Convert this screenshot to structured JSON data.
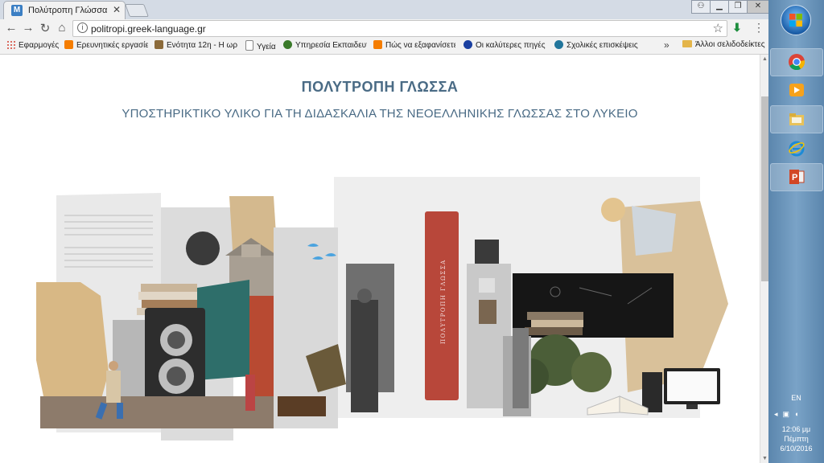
{
  "browser": {
    "tab_title": "Πολύτροπη Γλώσσα",
    "tab_favicon": "M",
    "url": "politropi.greek-language.gr",
    "bookmarks": [
      {
        "label": "Εφαρμογές",
        "icon": "apps-icon",
        "color": "#d23f31"
      },
      {
        "label": "Ερευνητικές εργασίες",
        "icon": "blogger-icon",
        "color": "#f57d00"
      },
      {
        "label": "Ενότητα 12η - Η ωρ",
        "icon": "page-image-icon",
        "color": "#8b6a3a"
      },
      {
        "label": "Υγεία",
        "icon": "page-icon",
        "color": "#888888"
      },
      {
        "label": "Υπηρεσία Εκπαιδευτ",
        "icon": "site-icon",
        "color": "#3a7a2a"
      },
      {
        "label": "Πώς να εξαφανίσετε",
        "icon": "blogger-icon",
        "color": "#f57d00"
      },
      {
        "label": "Οι καλύτερες πηγές",
        "icon": "info-icon",
        "color": "#1a3fa0"
      },
      {
        "label": "Σχολικές επισκέψεις",
        "icon": "wordpress-icon",
        "color": "#21759b"
      }
    ],
    "bookmarks_more": "»",
    "other_bookmarks": "Άλλοι σελιδοδείκτες"
  },
  "page": {
    "title": "ΠΟΛΥΤΡΟΠΗ ΓΛΩΣΣΑ",
    "subtitle": "ΥΠΟΣΤΗΡΙΚΤΙΚΟ ΥΛΙΚΟ ΓΙΑ ΤΗ ΔΙΔΑΣΚΑΛΙΑ ΤΗΣ ΝΕΟΕΛΛΗΝΙΚΗΣ ΓΛΩΣΣΑΣ ΣΤΟ ΛΥΚΕΙΟ",
    "book_spine_text": "ΠΟΛΥΤΡΟΠΗ ΓΛΩΣΣΑ",
    "accent_color": "#4a6b85"
  },
  "taskbar": {
    "apps": [
      "chrome-icon",
      "media-player-icon",
      "file-explorer-icon",
      "internet-explorer-icon",
      "powerpoint-icon"
    ],
    "language": "EN",
    "time": "12:06 μμ",
    "day": "Πέμπτη",
    "date": "6/10/2016"
  }
}
